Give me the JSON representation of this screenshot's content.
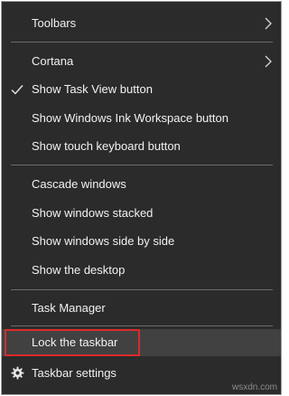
{
  "menu": {
    "items": [
      {
        "label": "Toolbars",
        "has_submenu": true
      },
      {
        "label": "Cortana",
        "has_submenu": true
      },
      {
        "label": "Show Task View button",
        "checked": true
      },
      {
        "label": "Show Windows Ink Workspace button"
      },
      {
        "label": "Show touch keyboard button"
      },
      {
        "label": "Cascade windows"
      },
      {
        "label": "Show windows stacked"
      },
      {
        "label": "Show windows side by side"
      },
      {
        "label": "Show the desktop"
      },
      {
        "label": "Task Manager"
      },
      {
        "label": "Lock the taskbar",
        "highlighted": true
      },
      {
        "label": "Taskbar settings",
        "icon": "gear-icon"
      }
    ]
  },
  "watermark": "wsxdn.com",
  "colors": {
    "menu_background": "#2b2b2b",
    "highlight_background": "#414141",
    "annotation_red": "#e02828",
    "text": "#f2f2f2"
  }
}
